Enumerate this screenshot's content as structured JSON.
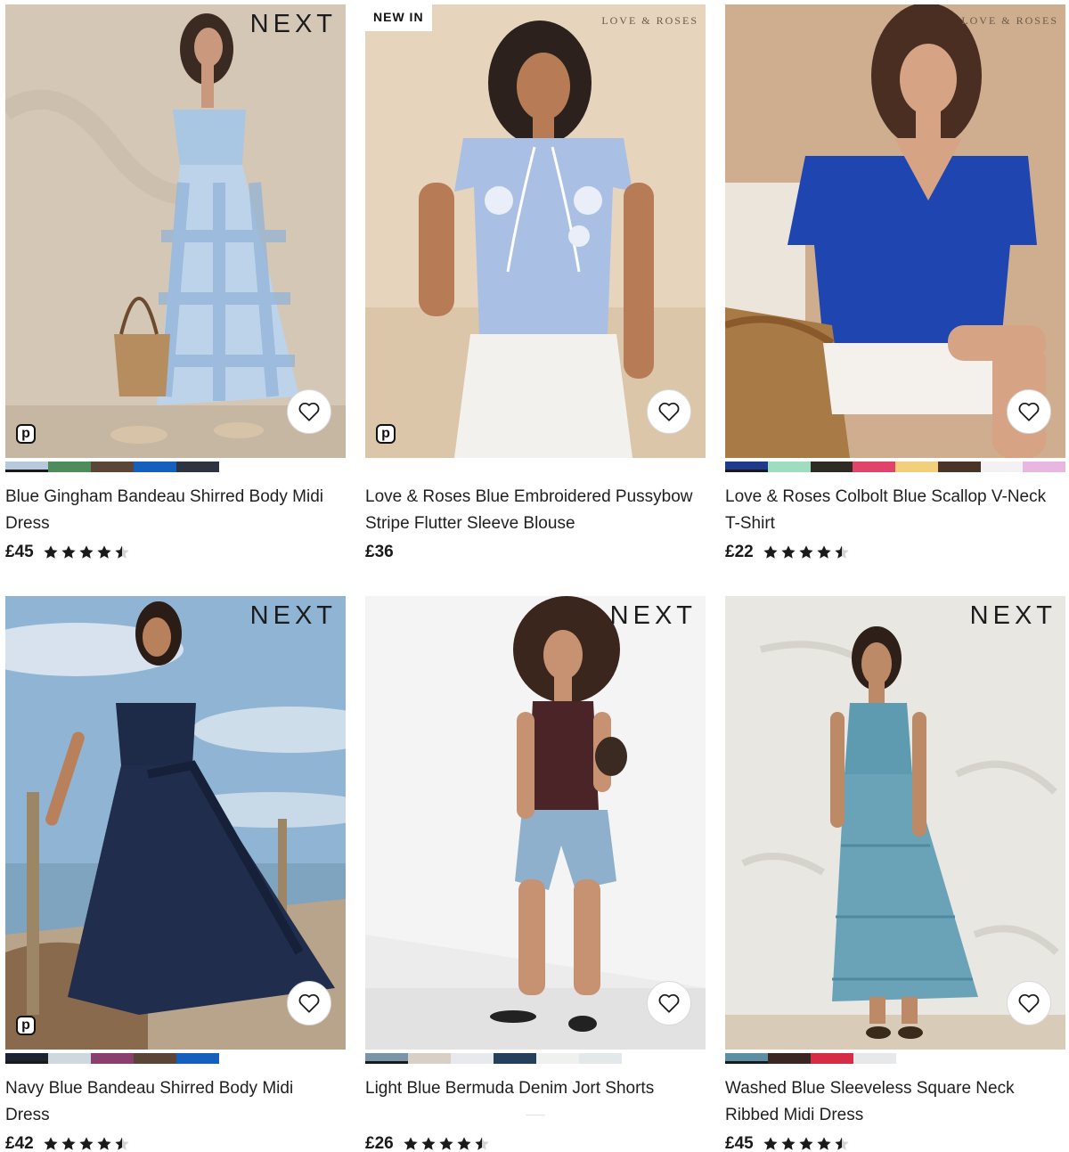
{
  "products": [
    {
      "name": "Blue Gingham Bandeau Shirred Body Midi Dress",
      "price": "£45",
      "brand": "NEXT",
      "badge": "",
      "pay_icon": "p",
      "rating": 4.5,
      "swatches": [
        "#b7c9dc",
        "#4e8d5b",
        "#5b4537",
        "#1560bd",
        "#2b3440"
      ],
      "selected_swatch": 0
    },
    {
      "name": "Love & Roses Blue Embroidered Pussybow Stripe Flutter Sleeve Blouse",
      "price": "£36",
      "brand": "LOVE & ROSES",
      "badge": "NEW IN",
      "pay_icon": "p",
      "rating": null,
      "swatches": [],
      "selected_swatch": null
    },
    {
      "name": "Love & Roses Colbolt Blue Scallop V-Neck T-Shirt",
      "price": "£22",
      "brand": "LOVE & ROSES",
      "badge": "",
      "pay_icon": "",
      "rating": 4.5,
      "swatches": [
        "#1e3a8a",
        "#9fdcc0",
        "#2f2a26",
        "#e0446a",
        "#f2cf7b",
        "#4a3428",
        "#f4f1f4",
        "#e8b7e0"
      ],
      "selected_swatch": 0
    },
    {
      "name": "Navy Blue Bandeau Shirred Body Midi Dress",
      "price": "£42",
      "brand": "NEXT",
      "badge": "",
      "pay_icon": "p",
      "rating": 4.5,
      "swatches": [
        "#1c2230",
        "#cfd8de",
        "#8b3f6f",
        "#5b4537",
        "#1560bd"
      ],
      "selected_swatch": 0
    },
    {
      "name": "Light Blue Bermuda Denim Jort Shorts",
      "price": "£26",
      "brand": "NEXT",
      "badge": "",
      "pay_icon": "",
      "rating": 4.5,
      "swatches": [
        "#7a94a8",
        "#d8d0c6",
        "#e7e9ec",
        "#24405c",
        "#eef1ee",
        "#e3e9ea"
      ],
      "selected_swatch": 0
    },
    {
      "name": "Washed Blue Sleeveless Square Neck Ribbed Midi Dress",
      "price": "£45",
      "brand": "NEXT",
      "badge": "",
      "pay_icon": "",
      "rating": 4.5,
      "swatches": [
        "#5d8fa4",
        "#3a2622",
        "#d62c45",
        "#e6e8ea"
      ],
      "selected_swatch": 0
    }
  ]
}
